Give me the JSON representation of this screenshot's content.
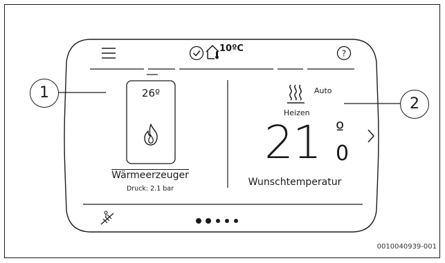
{
  "top_bar": {
    "menu_icon": "hamburger-menu-icon",
    "status_icon": "checkmark-circle-icon",
    "outdoor_icon": "house-thermometer-icon",
    "outdoor_temperature": "10ºC",
    "help_icon": "question-circle-icon"
  },
  "heat_source": {
    "tank_temperature": "26º",
    "flame_icon": "flame-icon",
    "name": "Wärmeerzeuger",
    "pressure": "Druck: 2.1 bar"
  },
  "heating": {
    "mode_icon": "heating-waves-icon",
    "mode_value": "Auto",
    "mode_name": "Heizen",
    "setpoint_integer": "21",
    "setpoint_degree": "º",
    "setpoint_decimal": "0",
    "setpoint_label": "Wunschtemperatur",
    "next_icon": "chevron-right-icon"
  },
  "bottom_bar": {
    "chimney_sweep_icon": "chimney-sweep-icon",
    "page_indicator": {
      "total": 5,
      "active": 1
    }
  },
  "callouts": [
    "1",
    "2"
  ],
  "figure_id": "0010040939-001"
}
